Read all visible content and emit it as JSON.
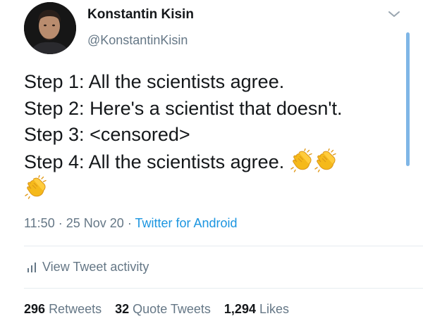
{
  "user": {
    "display_name": "Konstantin Kisin",
    "handle": "@KonstantinKisin"
  },
  "tweet": {
    "lines": [
      "Step 1: All the scientists agree.",
      "Step 2: Here's a scientist that doesn't.",
      "Step 3: <censored>",
      "Step 4: All the scientists agree."
    ],
    "emoji": [
      "clapping-hands",
      "clapping-hands",
      "clapping-hands"
    ]
  },
  "meta": {
    "time": "11:50",
    "date": "25 Nov 20",
    "source": "Twitter for Android"
  },
  "activity_label": "View Tweet activity",
  "stats": {
    "retweets_count": "296",
    "retweets_label": "Retweets",
    "quote_count": "32",
    "quote_label": "Quote Tweets",
    "likes_count": "1,294",
    "likes_label": "Likes"
  },
  "colors": {
    "text": "#14171a",
    "secondary": "#657786",
    "link": "#1b95e0",
    "divider": "#e6ecf0"
  }
}
